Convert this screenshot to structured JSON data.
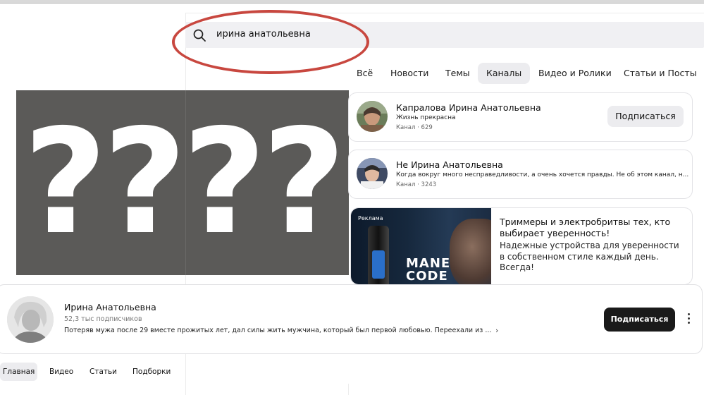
{
  "search": {
    "query": "ирина анатольевна"
  },
  "tabs": [
    {
      "label": "Всё",
      "active": false
    },
    {
      "label": "Новости",
      "active": false
    },
    {
      "label": "Темы",
      "active": false
    },
    {
      "label": "Каналы",
      "active": true
    },
    {
      "label": "Видео и Ролики",
      "active": false
    },
    {
      "label": "Статьи и Посты",
      "active": false
    }
  ],
  "image": {
    "text": "????"
  },
  "results": [
    {
      "title": "Капралова Ирина Анатольевна",
      "subtitle": "Жизнь прекрасна",
      "meta": "Канал · 629",
      "button": "Подписаться"
    },
    {
      "title": "Не Ирина Анатольевна",
      "subtitle": "Когда вокруг много несправедливости, а очень хочется правды. Не об этом канал, н...",
      "meta": "Канал · 3243"
    }
  ],
  "ad": {
    "label": "Реклама",
    "brand_line1": "MANE",
    "brand_line2": "CODE",
    "title": "Триммеры и электробритвы тех, кто выбирает уверенность!",
    "text": "Надежные устройства для уверенности в собственном стиле каждый день. Всегда!"
  },
  "channel": {
    "name": "Ирина Анатольевна",
    "subscribers": "52,3 тыс подписчиков",
    "description": "Потеряв мужа после 29 вместе прожитых лет, дал силы жить мужчина, который был первой любовью. Переехали из ...",
    "more": "›",
    "subscribe_label": "Подписаться"
  },
  "channel_nav": [
    {
      "label": "Главная",
      "active": true
    },
    {
      "label": "Видео",
      "active": false
    },
    {
      "label": "Статьи",
      "active": false
    },
    {
      "label": "Подборки",
      "active": false
    }
  ]
}
